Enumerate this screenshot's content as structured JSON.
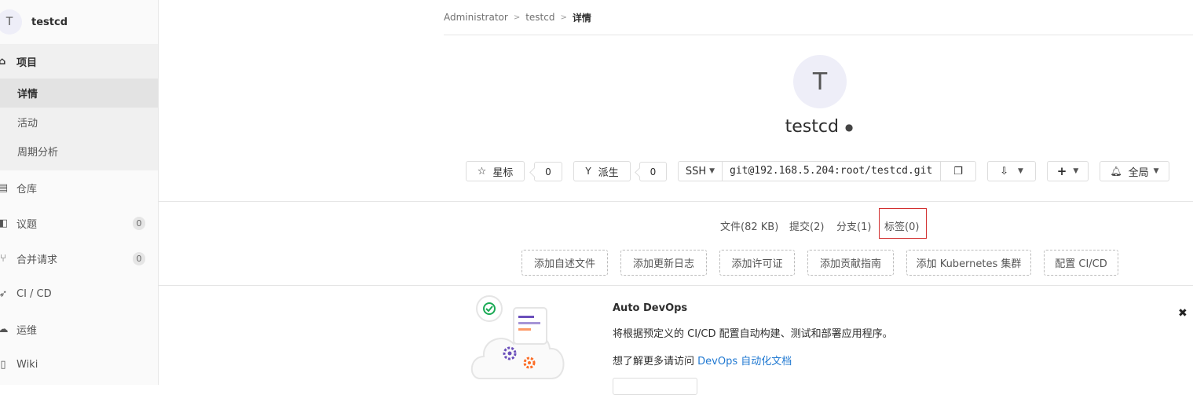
{
  "project": {
    "avatar_letter": "T",
    "name": "testcd"
  },
  "sidebar": {
    "section": {
      "label": "项目",
      "icon": "home-icon"
    },
    "sub_items": [
      {
        "label": "详情",
        "active": true
      },
      {
        "label": "活动",
        "active": false
      },
      {
        "label": "周期分析",
        "active": false
      }
    ],
    "items": [
      {
        "label": "仓库",
        "icon": "repository-icon"
      },
      {
        "label": "议题",
        "icon": "issues-icon",
        "badge": "0"
      },
      {
        "label": "合并请求",
        "icon": "merge-request-icon",
        "badge": "0"
      },
      {
        "label": "CI / CD",
        "icon": "rocket-icon"
      },
      {
        "label": "运维",
        "icon": "cloud-gear-icon"
      },
      {
        "label": "Wiki",
        "icon": "book-icon"
      }
    ]
  },
  "breadcrumb": {
    "root": "Administrator",
    "project": "testcd",
    "current": "详情"
  },
  "actions": {
    "star_label": "星标",
    "star_count": "0",
    "fork_label": "派生",
    "fork_count": "0",
    "protocol": "SSH",
    "clone_url": "git@192.168.5.204:root/testcd.git",
    "notification_label": "全局"
  },
  "stats": {
    "files": "文件(82 KB)",
    "commits": "提交(2)",
    "branches": "分支(1)",
    "tags": "标签(0)"
  },
  "quick_actions": [
    "添加自述文件",
    "添加更新日志",
    "添加许可证",
    "添加贡献指南",
    "添加 Kubernetes 集群",
    "配置 CI/CD"
  ],
  "banner": {
    "title": "Auto DevOps",
    "description": "将根据预定义的 CI/CD 配置自动构建、测试和部署应用程序。",
    "more_prefix": "想了解更多请访问 ",
    "more_link": "DevOps 自动化文档",
    "close": "✖"
  },
  "colors": {
    "link": "#1f78d1",
    "highlight_border": "#d22f2f",
    "avatar_bg": "#eeeef8"
  }
}
